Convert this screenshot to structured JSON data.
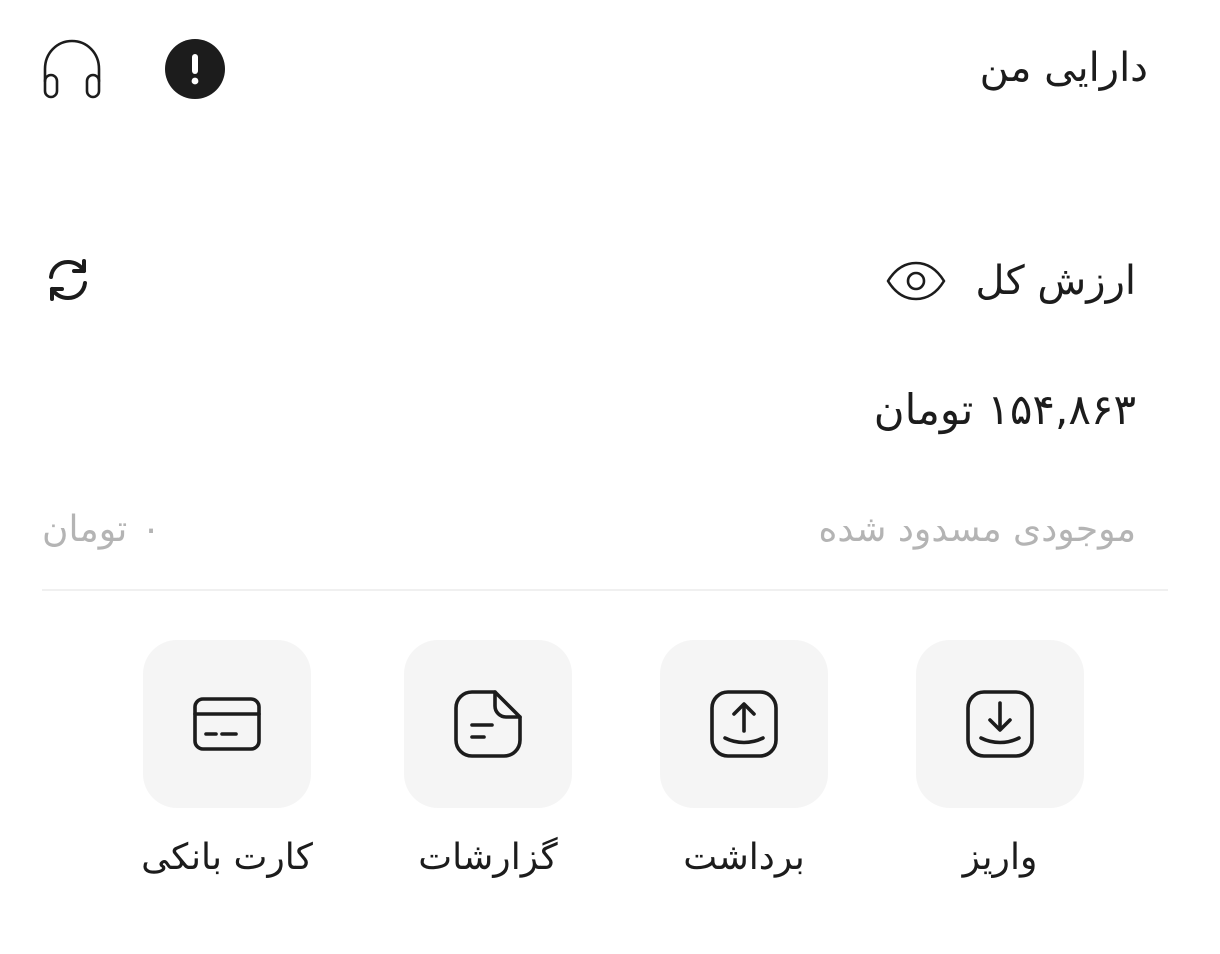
{
  "header": {
    "title": "دارایی من"
  },
  "total": {
    "label": "ارزش کل",
    "amount": "۱۵۴,۸۶۳",
    "currency": "تومان"
  },
  "blocked": {
    "label": "موجودی مسدود شده",
    "amount": "۰",
    "currency": "تومان"
  },
  "actions": [
    {
      "label": "واریز",
      "icon": "deposit-download-icon"
    },
    {
      "label": "برداشت",
      "icon": "withdraw-upload-icon"
    },
    {
      "label": "گزارشات",
      "icon": "reports-document-icon"
    },
    {
      "label": "کارت بانکی",
      "icon": "bank-card-icon"
    }
  ],
  "icons": {
    "support": "headphones-icon",
    "info": "exclamation-icon",
    "visibility": "eye-icon",
    "refresh": "refresh-icon"
  },
  "colors": {
    "text": "#1c1c1c",
    "muted": "#b4b4b4",
    "tile": "#f5f5f5",
    "divider": "#f0f0f0"
  }
}
